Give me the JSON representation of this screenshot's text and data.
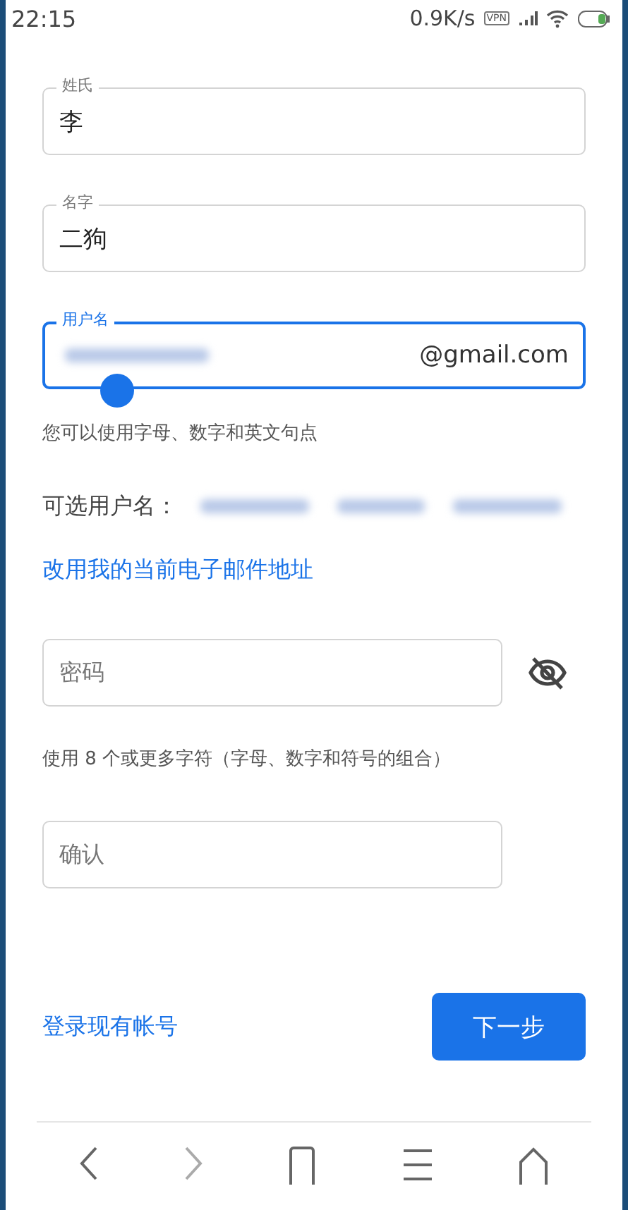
{
  "status_bar": {
    "time": "22:15",
    "speed": "0.9K/s",
    "vpn": "VPN"
  },
  "name_fields": [
    {
      "label": "姓氏",
      "value": "李",
      "focused": false
    },
    {
      "label": "名字",
      "value": "二狗",
      "focused": false
    }
  ],
  "username": {
    "label": "用户名",
    "suffix": "@gmail.com",
    "focused": true,
    "hint": "您可以使用字母、数字和英文句点"
  },
  "suggestions": {
    "label": "可选用户名："
  },
  "use_email_link": "改用我的当前电子邮件地址",
  "password": {
    "placeholder": "密码",
    "hint": "使用 8 个或更多字符（字母、数字和符号的组合）"
  },
  "confirm": {
    "placeholder": "确认"
  },
  "sign_in_link": "登录现有帐号",
  "next_button": "下一步"
}
